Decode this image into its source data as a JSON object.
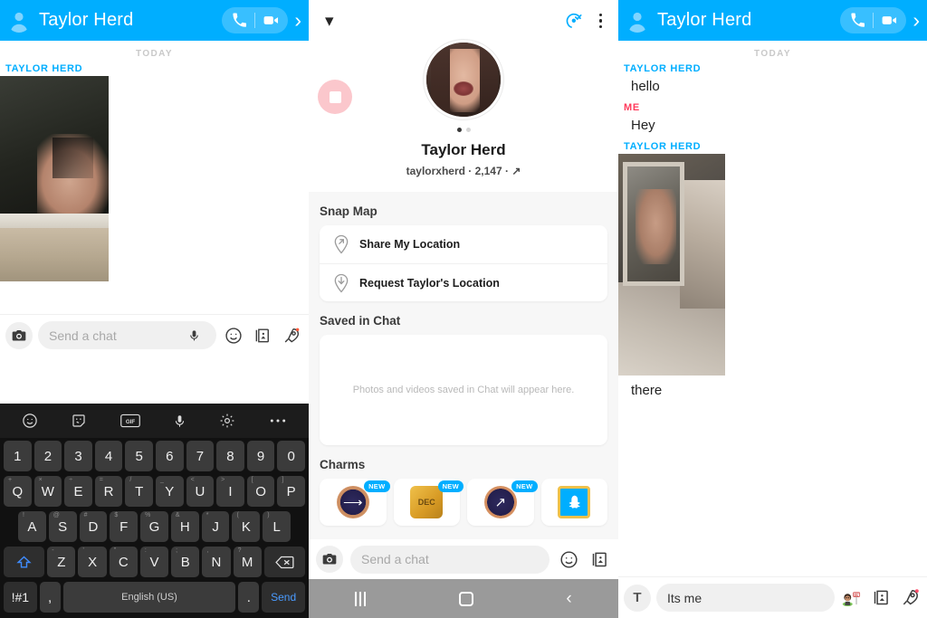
{
  "app": "Snapchat",
  "panels": {
    "left": {
      "header": {
        "title": "Taylor Herd",
        "avatar_icon": "person-icon",
        "call_icon": "phone-icon",
        "video_icon": "video-camera-icon",
        "forward_icon": "chevron-right-icon"
      },
      "chat": {
        "day_divider": "TODAY",
        "messages": [
          {
            "sender": "TAYLOR HERD",
            "type": "image",
            "direction": "incoming"
          }
        ]
      },
      "input": {
        "placeholder": "Send a chat",
        "value": "",
        "camera_icon": "camera-icon",
        "mic_icon": "microphone-icon",
        "icons": [
          "emoji-icon",
          "sticker-cards-icon",
          "rocket-icon"
        ]
      },
      "keyboard": {
        "toolbar_icons": [
          "emoji-icon",
          "sticker-icon",
          "gif-icon",
          "microphone-icon",
          "gear-icon",
          "overflow-icon"
        ],
        "rows": [
          [
            {
              "main": "1",
              "sup": ""
            },
            {
              "main": "2",
              "sup": ""
            },
            {
              "main": "3",
              "sup": ""
            },
            {
              "main": "4",
              "sup": ""
            },
            {
              "main": "5",
              "sup": ""
            },
            {
              "main": "6",
              "sup": ""
            },
            {
              "main": "7",
              "sup": ""
            },
            {
              "main": "8",
              "sup": ""
            },
            {
              "main": "9",
              "sup": ""
            },
            {
              "main": "0",
              "sup": ""
            }
          ],
          [
            {
              "main": "Q",
              "sup": "+"
            },
            {
              "main": "W",
              "sup": "×"
            },
            {
              "main": "E",
              "sup": "÷"
            },
            {
              "main": "R",
              "sup": "="
            },
            {
              "main": "T",
              "sup": "/"
            },
            {
              "main": "Y",
              "sup": "_"
            },
            {
              "main": "U",
              "sup": "<"
            },
            {
              "main": "I",
              "sup": ">"
            },
            {
              "main": "O",
              "sup": "["
            },
            {
              "main": "P",
              "sup": "]"
            }
          ],
          [
            {
              "main": "A",
              "sup": "!"
            },
            {
              "main": "S",
              "sup": "@"
            },
            {
              "main": "D",
              "sup": "#"
            },
            {
              "main": "F",
              "sup": "$"
            },
            {
              "main": "G",
              "sup": "%"
            },
            {
              "main": "H",
              "sup": "&"
            },
            {
              "main": "J",
              "sup": "*"
            },
            {
              "main": "K",
              "sup": "("
            },
            {
              "main": "L",
              "sup": ")"
            }
          ],
          [
            {
              "main": "Z",
              "sup": "-"
            },
            {
              "main": "X",
              "sup": "'"
            },
            {
              "main": "C",
              "sup": "\""
            },
            {
              "main": "V",
              "sup": ":"
            },
            {
              "main": "B",
              "sup": ";"
            },
            {
              "main": "N",
              "sup": ","
            },
            {
              "main": "M",
              "sup": "?"
            }
          ]
        ],
        "shift_icon": "shift-arrow-icon",
        "backspace_icon": "backspace-icon",
        "symbols_key": "!#1",
        "comma_key": ",",
        "space_key": "English (US)",
        "period_key": ".",
        "send_key": "Send"
      }
    },
    "middle": {
      "topbar": {
        "collapse_icon": "chevron-down-icon",
        "friend_added_icon": "friend-added-check-icon",
        "menu_icon": "kebab-menu-icon"
      },
      "profile": {
        "avatar_icon": "profile-photo",
        "name": "Taylor Herd",
        "username": "taylorxherd",
        "snapscore": "2,147",
        "zodiac_icon": "sagittarius-icon",
        "subtitle": "taylorxherd · 2,147 · ↗",
        "snap_badge_icon": "new-snap-badge",
        "carousel_dots": 2,
        "carousel_active": 0
      },
      "snap_map": {
        "title": "Snap Map",
        "items": [
          {
            "label": "Share My Location",
            "icon": "location-pin-arrow-up-icon"
          },
          {
            "label": "Request Taylor's Location",
            "icon": "location-pin-arrow-down-icon"
          }
        ]
      },
      "saved_in_chat": {
        "title": "Saved in Chat",
        "empty_text": "Photos and videos saved in Chat will appear here."
      },
      "charms": {
        "title": "Charms",
        "items": [
          {
            "badge": "NEW",
            "icon": "zodiac-charm-icon"
          },
          {
            "badge": "NEW",
            "icon": "dec-keychain-charm-icon"
          },
          {
            "badge": "NEW",
            "icon": "sagittarius-charm-icon"
          },
          {
            "badge": "",
            "icon": "snapchat-ghost-charm-icon"
          }
        ]
      },
      "input": {
        "placeholder": "Send a chat",
        "value": "",
        "camera_icon": "camera-icon",
        "icons": [
          "emoji-icon",
          "sticker-cards-icon"
        ]
      },
      "navbar": {
        "recents_icon": "recents-bars-icon",
        "home_icon": "home-square-icon",
        "back_icon": "back-chevron-icon"
      }
    },
    "right": {
      "header": {
        "title": "Taylor Herd",
        "avatar_icon": "person-icon",
        "call_icon": "phone-icon",
        "video_icon": "video-camera-icon",
        "forward_icon": "chevron-right-icon"
      },
      "chat": {
        "day_divider": "TODAY",
        "messages": [
          {
            "sender": "TAYLOR HERD",
            "direction": "incoming",
            "type": "text",
            "text": "hello"
          },
          {
            "sender": "ME",
            "direction": "outgoing",
            "type": "text",
            "text": "Hey"
          },
          {
            "sender": "TAYLOR HERD",
            "direction": "incoming",
            "type": "image",
            "text": ""
          },
          {
            "sender": "",
            "direction": "incoming",
            "type": "text",
            "text": "there"
          }
        ]
      },
      "input": {
        "placeholder": "Send a chat",
        "value": "Its me",
        "text_mode_icon": "text-T-icon",
        "icons": [
          "bitmoji-icon",
          "sticker-cards-icon",
          "rocket-icon"
        ]
      }
    }
  },
  "colors": {
    "snap_blue": "#00AEFF",
    "me_red": "#FF3B5C",
    "panel_bg": "#f7f7f7",
    "keyboard_bg": "#111111",
    "navbar_gray": "#9a9a9a",
    "badge_pink": "#FBC7CC"
  }
}
